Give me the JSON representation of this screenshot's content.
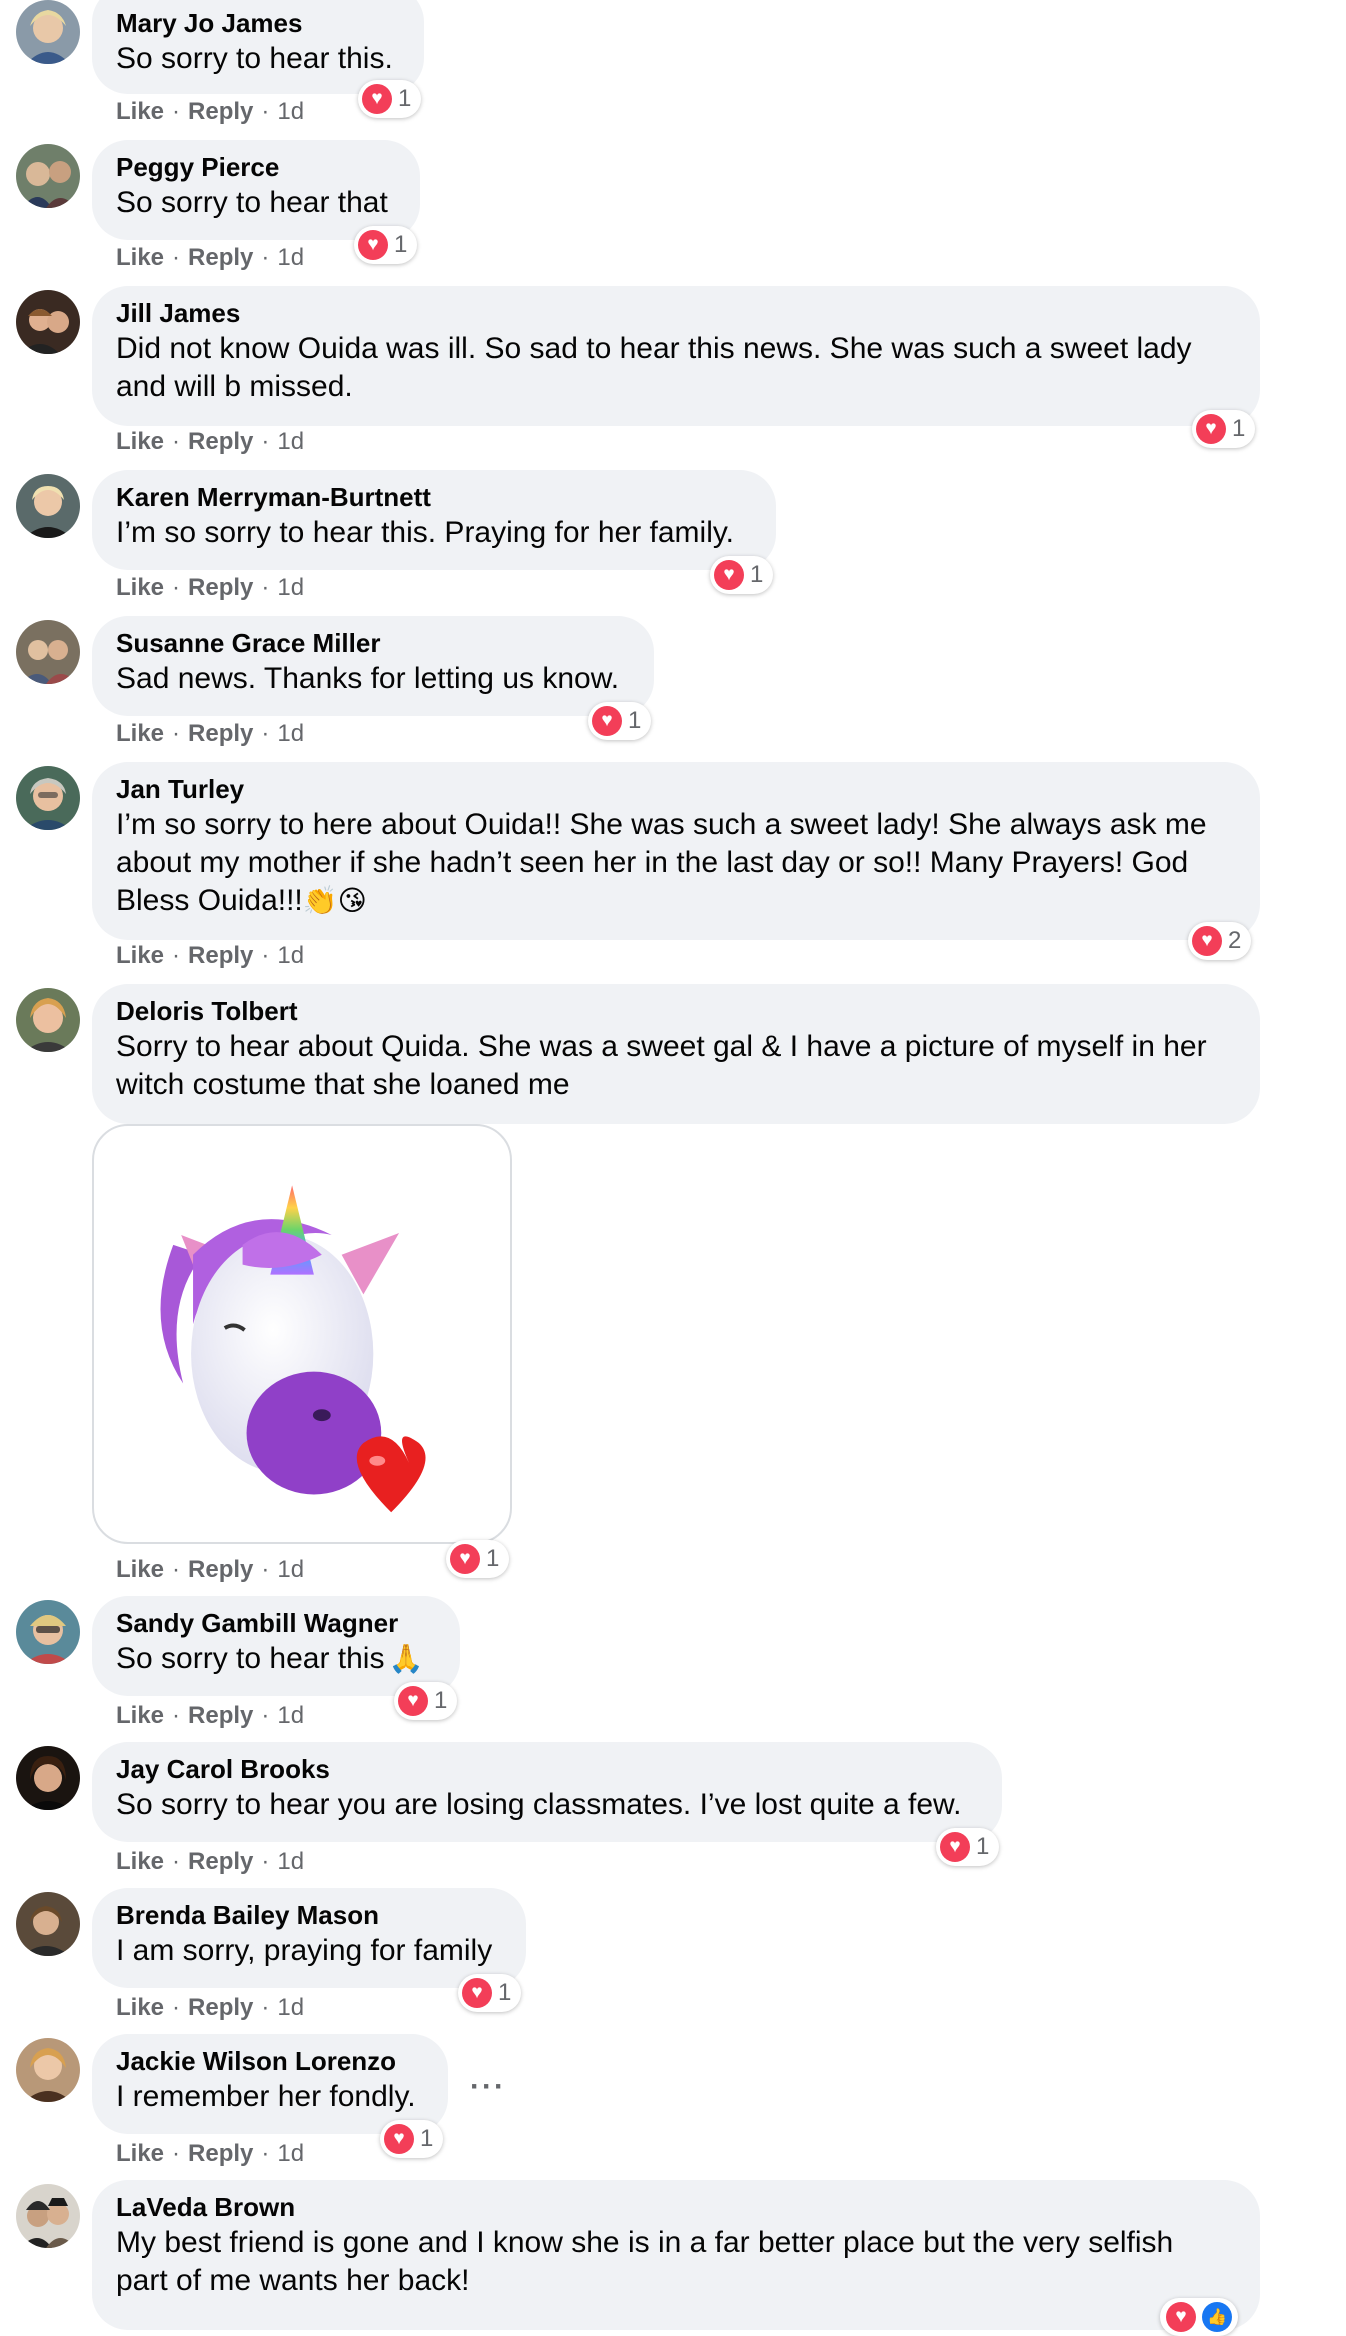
{
  "actions": {
    "like": "Like",
    "reply": "Reply",
    "separator": "·"
  },
  "comments": [
    {
      "author": "Mary Jo James",
      "text": "So sorry to hear this.",
      "time": "1d",
      "reaction_count": "1"
    },
    {
      "author": "Peggy Pierce",
      "text": "So sorry to hear that",
      "time": "1d",
      "reaction_count": "1"
    },
    {
      "author": "Jill James",
      "text_lines": [
        "Did not know Ouida was ill. So sad to hear this news. She was such a sweet lady",
        "and will b missed."
      ],
      "time": "1d",
      "reaction_count": "1"
    },
    {
      "author": "Karen Merryman-Burtnett",
      "text": "I’m so sorry to hear this. Praying for her family.",
      "time": "1d",
      "reaction_count": "1"
    },
    {
      "author": "Susanne Grace Miller",
      "text": "Sad news. Thanks for letting us know.",
      "time": "1d",
      "reaction_count": "1"
    },
    {
      "author": "Jan Turley",
      "text_lines": [
        "I’m so sorry to here about Ouida!! She was such a sweet lady! She always ask me",
        "about my mother if she hadn’t seen her in the last day or so!! Many Prayers! God",
        "Bless Ouida!!!"
      ],
      "emojis": "👏😘",
      "time": "1d",
      "reaction_count": "2"
    },
    {
      "author": "Deloris Tolbert",
      "text_lines": [
        "Sorry to hear about Quida. She was a sweet gal & I have a picture of myself in her",
        "witch costume that she loaned me"
      ],
      "time": "1d",
      "reaction_count": "1"
    },
    {
      "author": "Sandy Gambill Wagner",
      "text": "So sorry to hear this",
      "emojis": "🙏",
      "time": "1d",
      "reaction_count": "1"
    },
    {
      "author": "Jay Carol Brooks",
      "text": "So sorry to hear you are losing classmates. I’ve lost quite a few.",
      "time": "1d",
      "reaction_count": "1"
    },
    {
      "author": "Brenda Bailey Mason",
      "text": "I am sorry, praying for family",
      "time": "1d",
      "reaction_count": "1"
    },
    {
      "author": "Jackie Wilson Lorenzo",
      "text": "I remember her fondly.",
      "time": "1d",
      "reaction_count": "1",
      "more": "···"
    },
    {
      "author": "LaVeda Brown",
      "text_lines": [
        "My best friend is gone and I know she is in a far better place but the very selfish",
        "part of me wants her back!"
      ]
    }
  ],
  "colors": {
    "bubble": "#f0f2f5",
    "heart": "#f33e58",
    "meta": "#65676b",
    "like": "#1877f2"
  }
}
